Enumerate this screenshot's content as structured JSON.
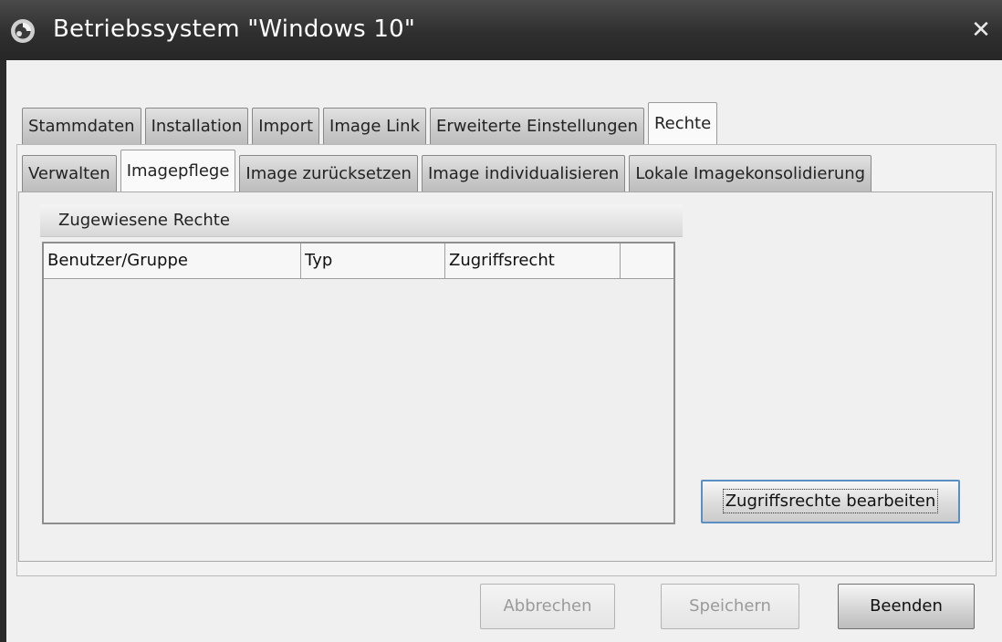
{
  "window": {
    "title": "Betriebssystem \"Windows 10\"",
    "close_glyph": "✕",
    "icon": "app-logo-icon"
  },
  "tabs_main": [
    {
      "label": "Stammdaten",
      "active": false
    },
    {
      "label": "Installation",
      "active": false
    },
    {
      "label": "Import",
      "active": false
    },
    {
      "label": "Image Link",
      "active": false
    },
    {
      "label": "Erweiterte Einstellungen",
      "active": false
    },
    {
      "label": "Rechte",
      "active": true
    }
  ],
  "tabs_sub": [
    {
      "label": "Verwalten",
      "active": false
    },
    {
      "label": "Imagepflege",
      "active": true
    },
    {
      "label": "Image zurücksetzen",
      "active": false
    },
    {
      "label": "Image individualisieren",
      "active": false
    },
    {
      "label": "Lokale Imagekonsolidierung",
      "active": false
    }
  ],
  "group": {
    "title": "Zugewiesene Rechte"
  },
  "table": {
    "columns": [
      "Benutzer/Gruppe",
      "Typ",
      "Zugriffsrecht",
      ""
    ],
    "rows": []
  },
  "buttons": {
    "edit_rights": "Zugriffsrechte bearbeiten",
    "cancel": "Abbrechen",
    "save": "Speichern",
    "close": "Beenden"
  },
  "colors": {
    "titlebar": "#2f2f2f",
    "focus_border": "#5a8fc4"
  }
}
